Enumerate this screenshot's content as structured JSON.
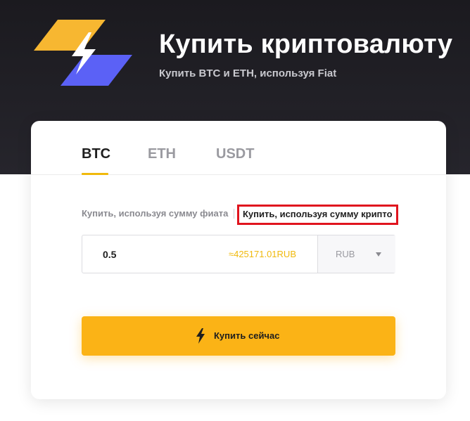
{
  "hero": {
    "title": "Купить криптовалюту",
    "subtitle": "Купить BTC и ETH, используя Fiat",
    "logo_icon": "lightning-logo-icon"
  },
  "tabs": [
    {
      "label": "BTC",
      "active": true
    },
    {
      "label": "ETH",
      "active": false
    },
    {
      "label": "USDT",
      "active": false
    }
  ],
  "modes": {
    "fiat_label": "Купить, используя сумму фиата",
    "crypto_label": "Купить, используя сумму крипто",
    "selected": "crypto"
  },
  "amount": {
    "value": "0.5",
    "equivalent": "≈425171.01RUB"
  },
  "currency": {
    "selected": "RUB"
  },
  "buy_button": {
    "label": "Купить сейчас",
    "icon": "lightning-icon"
  },
  "colors": {
    "accent": "#f0b90b",
    "button": "#fbb316",
    "hero_bg": "#1b1a1f",
    "logo_yellow": "#f7b731",
    "logo_blue": "#5b61f6",
    "highlight_border": "#e0141e"
  }
}
